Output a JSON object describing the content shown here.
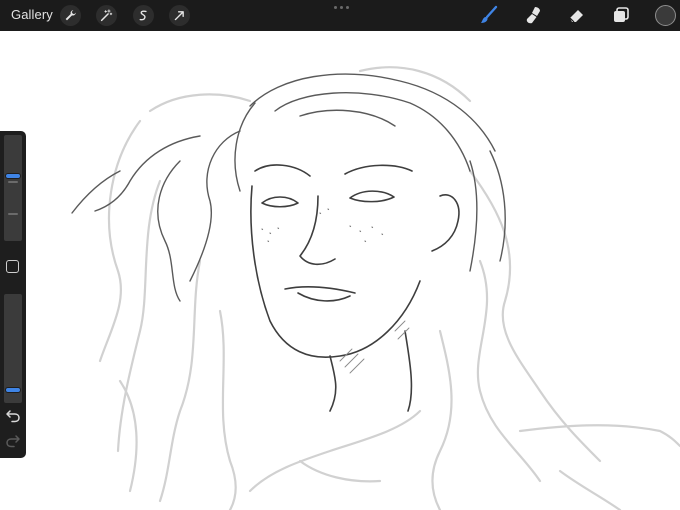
{
  "toolbar": {
    "gallery_label": "Gallery",
    "left_tools": [
      "wrench-icon",
      "magic-wand-icon",
      "selection-icon",
      "transform-arrow-icon"
    ],
    "right_tools": [
      "brush-icon",
      "smudge-icon",
      "eraser-icon",
      "layers-icon"
    ],
    "active_tool": "brush-icon",
    "accent_color": "#3f84e5",
    "current_color": "#3a3a3a"
  },
  "sidebar": {
    "brush_size_level": 0.62,
    "brush_opacity_level": 0.1
  }
}
